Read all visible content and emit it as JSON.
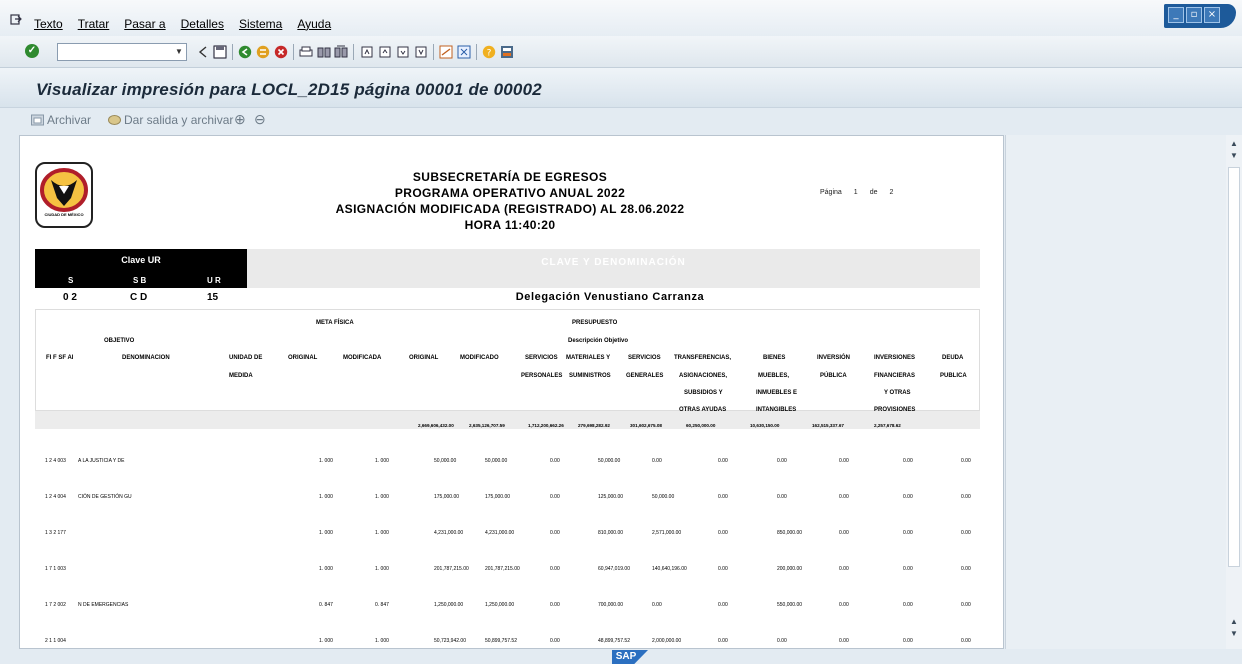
{
  "menu": {
    "items": [
      "Texto",
      "Tratar",
      "Pasar a",
      "Detalles",
      "Sistema",
      "Ayuda"
    ]
  },
  "toolbar": {
    "command_value": ""
  },
  "title": "Visualizar impresión para LOCL_2D15 página 00001 de 00002",
  "app_toolbar": {
    "archive": "Archivar",
    "output_archive": "Dar salida y archivar"
  },
  "doc": {
    "header": {
      "line1": "SUBSECRETARÍA   DE   EGRESOS",
      "line2": "PROGRAMA   OPERATIVO   ANUAL   2022",
      "line3": "ASIGNACIÓN    MODIFICADA (REGISTRADO)    AL    28.06.2022",
      "line4": "HORA    11:40:20"
    },
    "logo_text": "CIUDAD DE MÉXICO",
    "page_label": "Página",
    "page_num": "1",
    "page_of": "de",
    "page_total": "2",
    "clave_label": "Clave  UR",
    "cd_label": "CLAVE    Y    DENOMINACIÓN",
    "s_label": "S",
    "sb_label": "S B",
    "ur_label": "U R",
    "s_val": "0 2",
    "sb_val": "C D",
    "ur_val": "15",
    "delegacion": "Delegación  Venustiano  Carranza",
    "columns": {
      "meta_fisica": "META  FÍSICA",
      "presupuesto": "PRESUPUESTO",
      "objetivo": "OBJETIVO",
      "descripcion": "Descripción Objetivo",
      "fifsfai": "FI F SF AI",
      "denominacion": "DENOMINACION",
      "unidad1": "UNIDAD DE",
      "unidad2": "MEDIDA",
      "original": "ORIGINAL",
      "modificada": "MODIFICADA",
      "original2": "ORIGINAL",
      "modificado": "MODIFICADO",
      "servicios_pers1": "SERVICIOS",
      "servicios_pers2": "PERSONALES",
      "materiales1": "MATERIALES Y",
      "materiales2": "SUMINISTROS",
      "servicios_gen1": "SERVICIOS",
      "servicios_gen2": "GENERALES",
      "transf1": "TRANSFERENCIAS,",
      "transf2": "ASIGNACIONES,",
      "transf3": "SUBSIDIOS Y",
      "transf4": "OTRAS AYUDAS",
      "bienes1": "BIENES",
      "bienes2": "MUEBLES,",
      "bienes3": "INMUEBLES  E",
      "bienes4": "INTANGIBLES",
      "inversion1": "INVERSIÓN",
      "inversion2": "PÚBLICA",
      "invfin1": "INVERSIONES",
      "invfin2": "FINANCIERAS",
      "invfin3": "Y  OTRAS",
      "invfin4": "PROVISIONES",
      "deuda1": "DEUDA",
      "deuda2": "PUBLICA"
    },
    "totals": [
      "2,669,606,432.00",
      "2,635,126,707.59",
      "1,712,200,662.26",
      "279,698,282.92",
      "301,602,675.08",
      "60,250,000.00",
      "10,630,150.00",
      "162,515,337.67",
      "2,257,678.62"
    ],
    "rows": [
      {
        "code": "1 2 4  003",
        "denom": "A  LA  JUSTICIA  Y  DE",
        "orig": "1. 000",
        "mod": "1. 000",
        "v": [
          "50,000.00",
          "50,000.00",
          "0.00",
          "50,000.00",
          "0.00",
          "0.00",
          "0.00",
          "0.00",
          "0.00",
          "0.00"
        ]
      },
      {
        "code": "1 2 4  004",
        "denom": "CIÓN  DE  GESTIÓN  GU",
        "orig": "1. 000",
        "mod": "1. 000",
        "v": [
          "175,000.00",
          "175,000.00",
          "0.00",
          "125,000.00",
          "50,000.00",
          "0.00",
          "0.00",
          "0.00",
          "0.00",
          "0.00"
        ]
      },
      {
        "code": "1 3 2  177",
        "denom": "",
        "orig": "1. 000",
        "mod": "1. 000",
        "v": [
          "4,231,000.00",
          "4,231,000.00",
          "0.00",
          "810,000.00",
          "2,571,000.00",
          "0.00",
          "850,000.00",
          "0.00",
          "0.00",
          "0.00"
        ]
      },
      {
        "code": "1 7 1  003",
        "denom": "",
        "orig": "1. 000",
        "mod": "1. 000",
        "v": [
          "201,787,215.00",
          "201,787,215.00",
          "0.00",
          "60,947,019.00",
          "140,640,196.00",
          "0.00",
          "200,000.00",
          "0.00",
          "0.00",
          "0.00"
        ]
      },
      {
        "code": "1 7 2  002",
        "denom": "N  DE  EMERGENCIAS",
        "orig": "0. 847",
        "mod": "0. 847",
        "v": [
          "1,250,000.00",
          "1,250,000.00",
          "0.00",
          "700,000.00",
          "0.00",
          "0.00",
          "550,000.00",
          "0.00",
          "0.00",
          "0.00"
        ]
      },
      {
        "code": "2 1 1  004",
        "denom": "",
        "orig": "1. 000",
        "mod": "1. 000",
        "v": [
          "50,723,942.00",
          "50,899,757.52",
          "0.00",
          "48,899,757.52",
          "2,000,000.00",
          "0.00",
          "0.00",
          "0.00",
          "0.00",
          "0.00"
        ]
      }
    ]
  }
}
